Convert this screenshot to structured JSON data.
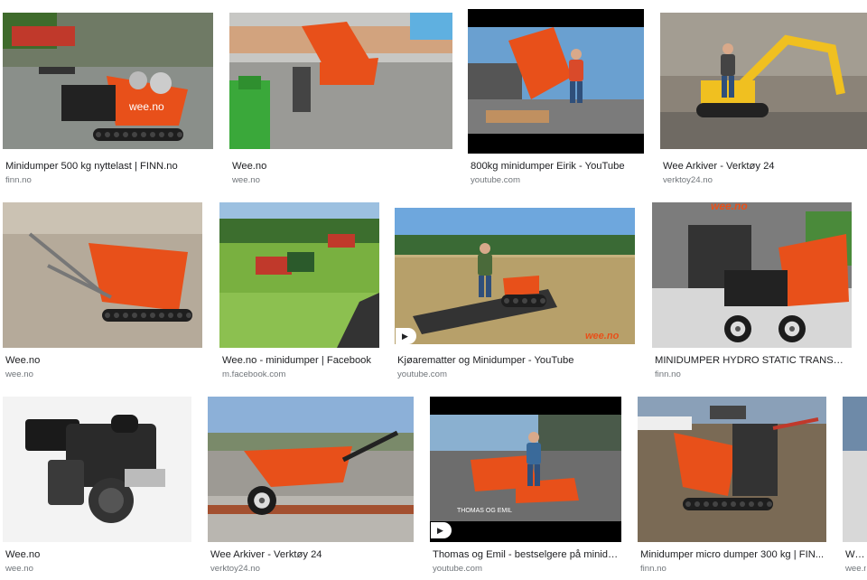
{
  "results": [
    {
      "title": "Minidumper 500 kg nyttelast | FINN.no",
      "source": "finn.no",
      "thumb_icon": "tracked-minidumper-image"
    },
    {
      "title": "Wee.no",
      "source": "wee.no",
      "thumb_icon": "minidumper-loading-gravel-image"
    },
    {
      "title": "800kg minidumper Eirik - YouTube",
      "source": "youtube.com",
      "thumb_icon": "man-with-minidumper-image"
    },
    {
      "title": "Wee Arkiver - Verktøy 24",
      "source": "verktoy24.no",
      "thumb_icon": "mini-excavator-image"
    },
    {
      "title": "Wee.no",
      "source": "wee.no",
      "thumb_icon": "dumper-indoor-floor-image"
    },
    {
      "title": "Wee.no - minidumper | Facebook",
      "source": "m.facebook.com",
      "thumb_icon": "tractor-field-image"
    },
    {
      "title": "Kjøarematter og Minidumper - YouTube",
      "source": "youtube.com",
      "thumb_icon": "man-on-ground-mats-image",
      "has_play": true,
      "watermark": "wee.no"
    },
    {
      "title": "MINIDUMPER HYDRO STATIC TRANSMISJ...",
      "source": "finn.no",
      "thumb_icon": "wheeled-minidumper-image",
      "watermark": "wee.no"
    },
    {
      "title": "Wee.no",
      "source": "wee.no",
      "thumb_icon": "petrol-engine-image"
    },
    {
      "title": "Wee Arkiver - Verktøy 24",
      "source": "verktoy24.no",
      "thumb_icon": "orange-wheelbarrow-image"
    },
    {
      "title": "Thomas og Emil - bestselgere på minidu...",
      "source": "youtube.com",
      "thumb_icon": "two-men-minidumpers-image",
      "has_play": true,
      "watermark": "THOMAS OG EMIL"
    },
    {
      "title": "Minidumper micro dumper 300 kg | FIN...",
      "source": "finn.no",
      "thumb_icon": "micro-dumper-gravel-image"
    },
    {
      "title": "Wee.",
      "source": "wee.n",
      "thumb_icon": "partial-image"
    }
  ],
  "watermarks": {
    "wee": "wee.no"
  },
  "colors": {
    "accent_orange": "#e8501a",
    "title_text": "#202124",
    "source_text": "#70757a"
  }
}
